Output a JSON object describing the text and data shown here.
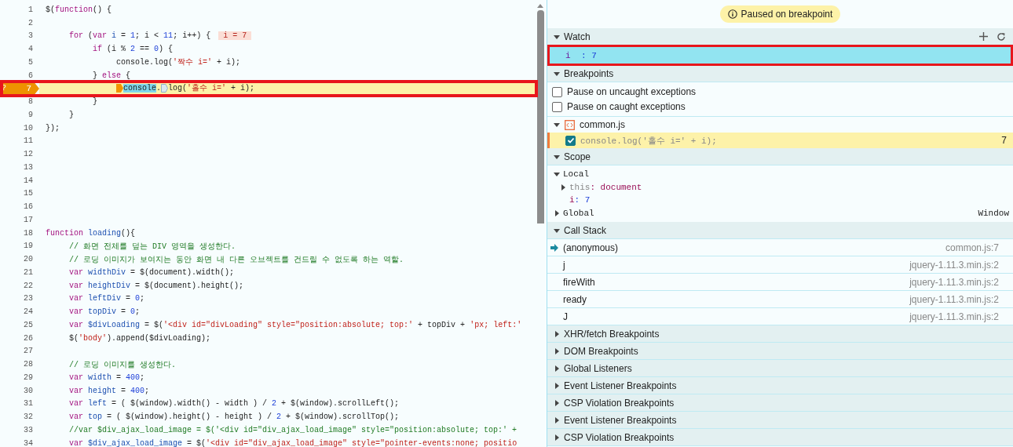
{
  "editor": {
    "lines": [
      {
        "number": "1",
        "segments": [
          {
            "kind": "plain",
            "text": "$("
          },
          {
            "kind": "kw",
            "text": "function"
          },
          {
            "kind": "plain",
            "text": "() {"
          }
        ],
        "children": [
          {
            "number": "2"
          },
          {
            "number": "3",
            "segments": [
              {
                "kind": "kw",
                "text": "for"
              },
              {
                "kind": "plain",
                "text": " ("
              },
              {
                "kind": "kw",
                "text": "var"
              },
              {
                "kind": "def",
                "text": " i"
              },
              {
                "kind": "plain",
                "text": " = "
              },
              {
                "kind": "num",
                "text": "1"
              },
              {
                "kind": "plain",
                "text": "; i < "
              },
              {
                "kind": "num",
                "text": "11"
              },
              {
                "kind": "plain",
                "text": "; i++) {"
              }
            ],
            "inline_value": "i = 7",
            "children": [
              {
                "number": "4",
                "segments": [
                  {
                    "kind": "kw",
                    "text": "if"
                  },
                  {
                    "kind": "plain",
                    "text": " (i % "
                  },
                  {
                    "kind": "num",
                    "text": "2"
                  },
                  {
                    "kind": "plain",
                    "text": " == "
                  },
                  {
                    "kind": "num",
                    "text": "0"
                  },
                  {
                    "kind": "plain",
                    "text": ") {"
                  }
                ],
                "children": [
                  {
                    "number": "5",
                    "segments": [
                      {
                        "kind": "plain",
                        "text": "console.log("
                      },
                      {
                        "kind": "str",
                        "text": "'짝수 i='"
                      },
                      {
                        "kind": "plain",
                        "text": " + i);"
                      }
                    ]
                  }
                ]
              },
              {
                "number": "6",
                "segments": [
                  {
                    "kind": "plain",
                    "text": "} "
                  },
                  {
                    "kind": "kw",
                    "text": "else"
                  },
                  {
                    "kind": "plain",
                    "text": " {"
                  }
                ],
                "children": [
                  {
                    "number": "7",
                    "paused": true,
                    "gutter_mark": "?",
                    "annotated": true,
                    "segments": [
                      {
                        "kind": "marker",
                        "active": true
                      },
                      {
                        "kind": "hl",
                        "text": "console"
                      },
                      {
                        "kind": "plain",
                        "text": "."
                      },
                      {
                        "kind": "marker",
                        "active": false
                      },
                      {
                        "kind": "plain",
                        "text": "log("
                      },
                      {
                        "kind": "str",
                        "text": "'홀수 i='"
                      },
                      {
                        "kind": "plain",
                        "text": " + i);"
                      }
                    ]
                  }
                ]
              },
              {
                "number": "8",
                "segments": [
                  {
                    "kind": "plain",
                    "text": "}"
                  }
                ]
              }
            ]
          },
          {
            "number": "9",
            "segments": [
              {
                "kind": "plain",
                "text": "}"
              }
            ]
          }
        ]
      },
      {
        "number": "10",
        "segments": [
          {
            "kind": "plain",
            "text": "});"
          }
        ]
      },
      {
        "number": "11"
      },
      {
        "number": "12"
      },
      {
        "number": "13"
      },
      {
        "number": "14"
      },
      {
        "number": "15"
      },
      {
        "number": "16"
      },
      {
        "number": "17"
      },
      {
        "number": "18",
        "segments": [
          {
            "kind": "kw",
            "text": "function"
          },
          {
            "kind": "def",
            "text": " loading"
          },
          {
            "kind": "plain",
            "text": "(){"
          }
        ],
        "children": [
          {
            "number": "19",
            "segments": [
              {
                "kind": "cmt",
                "text": "// 화면 전체를 덮는 DIV 영역을 생성한다."
              }
            ]
          },
          {
            "number": "20",
            "segments": [
              {
                "kind": "cmt",
                "text": "// 로딩 이미지가 보여지는 동안 화면 내 다른 오브젝트를 건드릴 수 없도록 하는 역할."
              }
            ]
          },
          {
            "number": "21",
            "segments": [
              {
                "kind": "kw",
                "text": "var"
              },
              {
                "kind": "def",
                "text": " widthDiv"
              },
              {
                "kind": "plain",
                "text": " = $(document).width();"
              }
            ]
          },
          {
            "number": "22",
            "segments": [
              {
                "kind": "kw",
                "text": "var"
              },
              {
                "kind": "def",
                "text": " heightDiv"
              },
              {
                "kind": "plain",
                "text": " = $(document).height();"
              }
            ]
          },
          {
            "number": "23",
            "segments": [
              {
                "kind": "kw",
                "text": "var"
              },
              {
                "kind": "def",
                "text": " leftDiv"
              },
              {
                "kind": "plain",
                "text": " = "
              },
              {
                "kind": "num",
                "text": "0"
              },
              {
                "kind": "plain",
                "text": ";"
              }
            ]
          },
          {
            "number": "24",
            "segments": [
              {
                "kind": "kw",
                "text": "var"
              },
              {
                "kind": "def",
                "text": " topDiv"
              },
              {
                "kind": "plain",
                "text": " = "
              },
              {
                "kind": "num",
                "text": "0"
              },
              {
                "kind": "plain",
                "text": ";"
              }
            ]
          },
          {
            "number": "25",
            "segments": [
              {
                "kind": "kw",
                "text": "var"
              },
              {
                "kind": "def",
                "text": " $divLoading"
              },
              {
                "kind": "plain",
                "text": " = $("
              },
              {
                "kind": "str",
                "text": "'<div id=\"divLoading\" style=\"position:absolute; top:'"
              },
              {
                "kind": "plain",
                "text": " + topDiv + "
              },
              {
                "kind": "str",
                "text": "'px; left:'"
              }
            ]
          },
          {
            "number": "26",
            "segments": [
              {
                "kind": "plain",
                "text": "$("
              },
              {
                "kind": "str",
                "text": "'body'"
              },
              {
                "kind": "plain",
                "text": ").append($divLoading);"
              }
            ]
          },
          {
            "number": "27"
          },
          {
            "number": "28",
            "segments": [
              {
                "kind": "cmt",
                "text": "// 로딩 이미지를 생성한다."
              }
            ]
          },
          {
            "number": "29",
            "segments": [
              {
                "kind": "kw",
                "text": "var"
              },
              {
                "kind": "def",
                "text": " width"
              },
              {
                "kind": "plain",
                "text": " = "
              },
              {
                "kind": "num",
                "text": "400"
              },
              {
                "kind": "plain",
                "text": ";"
              }
            ]
          },
          {
            "number": "30",
            "segments": [
              {
                "kind": "kw",
                "text": "var"
              },
              {
                "kind": "def",
                "text": " height"
              },
              {
                "kind": "plain",
                "text": " = "
              },
              {
                "kind": "num",
                "text": "400"
              },
              {
                "kind": "plain",
                "text": ";"
              }
            ]
          },
          {
            "number": "31",
            "segments": [
              {
                "kind": "kw",
                "text": "var"
              },
              {
                "kind": "def",
                "text": " left"
              },
              {
                "kind": "plain",
                "text": " = ( $(window).width() - width ) / "
              },
              {
                "kind": "num",
                "text": "2"
              },
              {
                "kind": "plain",
                "text": " + $(window).scrollLeft();"
              }
            ]
          },
          {
            "number": "32",
            "segments": [
              {
                "kind": "kw",
                "text": "var"
              },
              {
                "kind": "def",
                "text": " top"
              },
              {
                "kind": "plain",
                "text": " = ( $(window).height() - height ) / "
              },
              {
                "kind": "num",
                "text": "2"
              },
              {
                "kind": "plain",
                "text": " + $(window).scrollTop();"
              }
            ]
          },
          {
            "number": "33",
            "segments": [
              {
                "kind": "cmt",
                "text": "//var $div_ajax_load_image = $('<div id=\"div_ajax_load_image\" style=\"position:absolute; top:' +"
              }
            ]
          },
          {
            "number": "34",
            "segments": [
              {
                "kind": "kw",
                "text": "var"
              },
              {
                "kind": "def",
                "text": " $div_ajax_load_image"
              },
              {
                "kind": "plain",
                "text": " = $("
              },
              {
                "kind": "str",
                "text": "'<div id=\"div_ajax_load_image\" style=\"pointer-events:none; positio"
              }
            ]
          }
        ]
      }
    ]
  },
  "debugger": {
    "status": "Paused on breakpoint",
    "watch": {
      "title": "Watch",
      "expanded": true,
      "expressions": [
        {
          "name": "i",
          "value": ": 7",
          "annotated": true
        }
      ]
    },
    "breakpoints": {
      "title": "Breakpoints",
      "expanded": true,
      "options": [
        {
          "label": "Pause on uncaught exceptions",
          "checked": false
        },
        {
          "label": "Pause on caught exceptions",
          "checked": false
        }
      ],
      "files": [
        {
          "name": "common.js",
          "expanded": true,
          "entries": [
            {
              "code": "console.log('홀수 i=' + i);",
              "line": "7",
              "checked": true,
              "active": true
            }
          ]
        }
      ]
    },
    "scope": {
      "title": "Scope",
      "expanded": true,
      "groups": [
        {
          "name": "Local",
          "expanded": true,
          "vars": [
            {
              "name": "this",
              "value": ": document",
              "expandable": true
            },
            {
              "name": "i",
              "value": ": 7",
              "expandable": false
            }
          ]
        },
        {
          "name": "Global",
          "expanded": false,
          "value": "Window"
        }
      ]
    },
    "call_stack": {
      "title": "Call Stack",
      "expanded": true,
      "frames": [
        {
          "name": "(anonymous)",
          "location": "common.js:7",
          "selected": true
        },
        {
          "name": "j",
          "location": "jquery-1.11.3.min.js:2",
          "selected": false
        },
        {
          "name": "fireWith",
          "location": "jquery-1.11.3.min.js:2",
          "selected": false
        },
        {
          "name": "ready",
          "location": "jquery-1.11.3.min.js:2",
          "selected": false
        },
        {
          "name": "J",
          "location": "jquery-1.11.3.min.js:2",
          "selected": false
        }
      ]
    },
    "collapsed_panels": [
      {
        "title": "XHR/fetch Breakpoints",
        "expanded": false
      },
      {
        "title": "DOM Breakpoints",
        "expanded": false
      },
      {
        "title": "Global Listeners",
        "expanded": false
      },
      {
        "title": "Event Listener Breakpoints",
        "expanded": false
      },
      {
        "title": "CSP Violation Breakpoints",
        "expanded": false
      },
      {
        "title": "Event Listener Breakpoints",
        "expanded": false
      },
      {
        "title": "CSP Violation Breakpoints",
        "expanded": false
      }
    ]
  }
}
